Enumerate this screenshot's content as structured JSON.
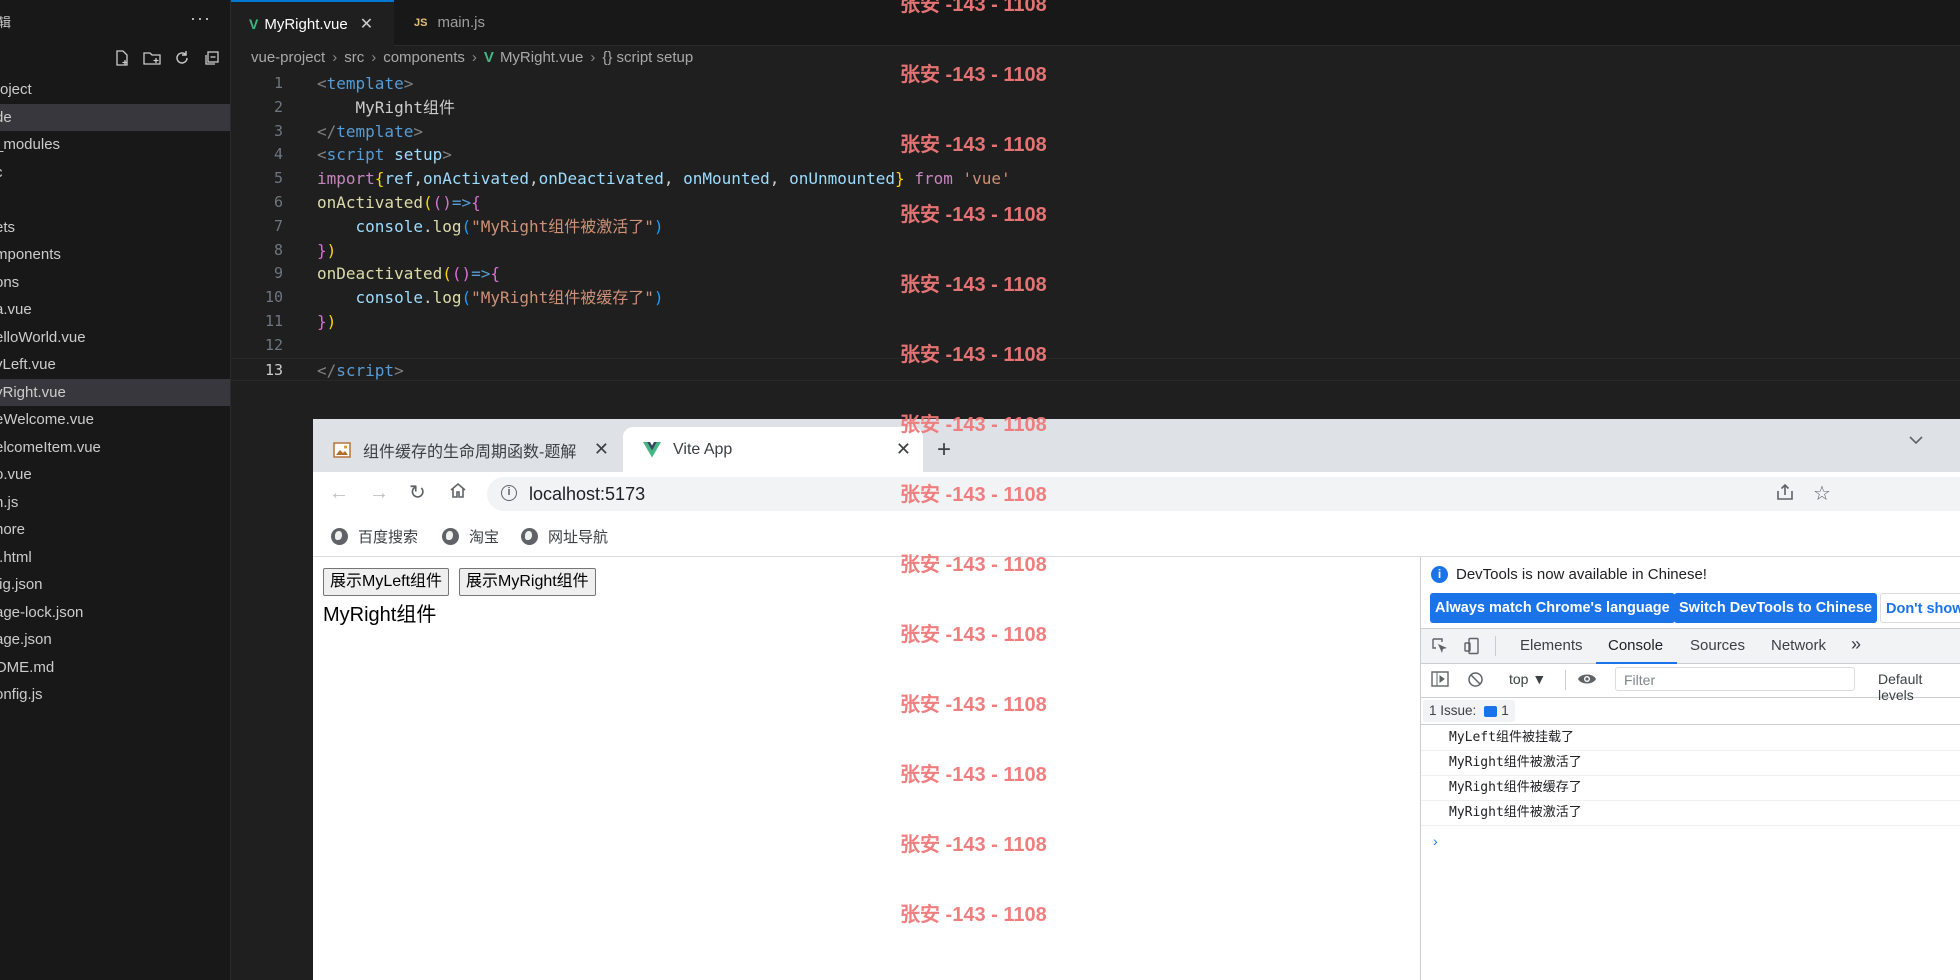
{
  "sidebar": {
    "title": "辑",
    "more": "···",
    "tree": [
      "roject",
      "de",
      "_modules",
      "c",
      "",
      "ets",
      "mponents",
      "ons",
      "a.vue",
      "elloWorld.vue",
      "yLeft.vue",
      "yRight.vue",
      "eWelcome.vue",
      "elcomeItem.vue",
      "o.vue",
      "n.js",
      "nore",
      "t.html",
      "fig.json",
      "age-lock.json",
      "age.json",
      "OME.md",
      "onfig.js"
    ],
    "selected_index": 11,
    "highlighted_index": 1
  },
  "editor": {
    "tabs": [
      {
        "icon": "V",
        "label": "MyRight.vue",
        "close": "✕"
      },
      {
        "icon": "JS",
        "label": "main.js"
      }
    ],
    "breadcrumb": [
      "vue-project",
      "src",
      "components",
      "MyRight.vue",
      "{} script setup"
    ],
    "breadcrumb_sep": "›",
    "line_numbers": [
      "1",
      "2",
      "3",
      "4",
      "5",
      "6",
      "7",
      "8",
      "9",
      "10",
      "11",
      "12",
      "13"
    ]
  },
  "browser": {
    "tabs": [
      {
        "label": "组件缓存的生命周期函数-题解",
        "close": "✕"
      },
      {
        "label": "Vite App",
        "close": "✕"
      }
    ],
    "new_tab": "+",
    "url": "localhost:5173",
    "bookmarks": [
      "百度搜索",
      "淘宝",
      "网址导航"
    ],
    "page": {
      "buttons": [
        "展示MyLeft组件",
        "展示MyRight组件"
      ],
      "text": "MyRight组件"
    }
  },
  "devtools": {
    "notice": "DevTools is now available in Chinese!",
    "notice_buttons": [
      "Always match Chrome's language",
      "Switch DevTools to Chinese",
      "Don't show"
    ],
    "tabs": [
      "Elements",
      "Console",
      "Sources",
      "Network"
    ],
    "active_tab": "Console",
    "context": "top ▼",
    "filter_placeholder": "Filter",
    "levels": "Default levels",
    "issues_label": "1 Issue:",
    "issues_count": "1",
    "logs": [
      "MyLeft组件被挂载了",
      "MyRight组件被激活了",
      "MyRight组件被缓存了",
      "MyRight组件被激活了"
    ],
    "prompt": "›"
  },
  "watermark": {
    "text": "张安 -143 - 1108",
    "color": "#f07878"
  },
  "colors": {
    "vue_green": "#41b883",
    "accent_blue": "#1a73e8"
  }
}
